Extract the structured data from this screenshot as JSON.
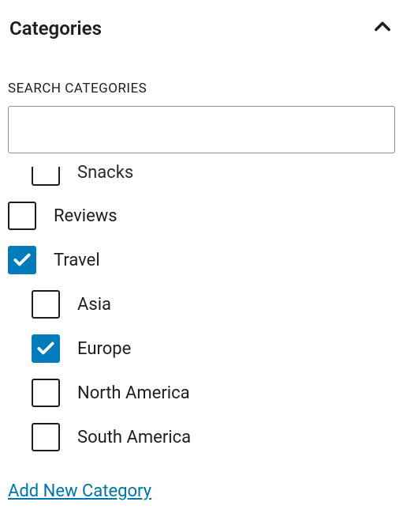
{
  "panel": {
    "title": "Categories",
    "expanded": true
  },
  "search": {
    "label": "SEARCH CATEGORIES",
    "value": ""
  },
  "categories": [
    {
      "label": "Snacks",
      "checked": false,
      "level": 1,
      "partial": true
    },
    {
      "label": "Reviews",
      "checked": false,
      "level": 0
    },
    {
      "label": "Travel",
      "checked": true,
      "level": 0
    },
    {
      "label": "Asia",
      "checked": false,
      "level": 1
    },
    {
      "label": "Europe",
      "checked": true,
      "level": 1
    },
    {
      "label": "North America",
      "checked": false,
      "level": 1
    },
    {
      "label": "South America",
      "checked": false,
      "level": 1
    }
  ],
  "addNew": {
    "label": "Add New Category"
  }
}
